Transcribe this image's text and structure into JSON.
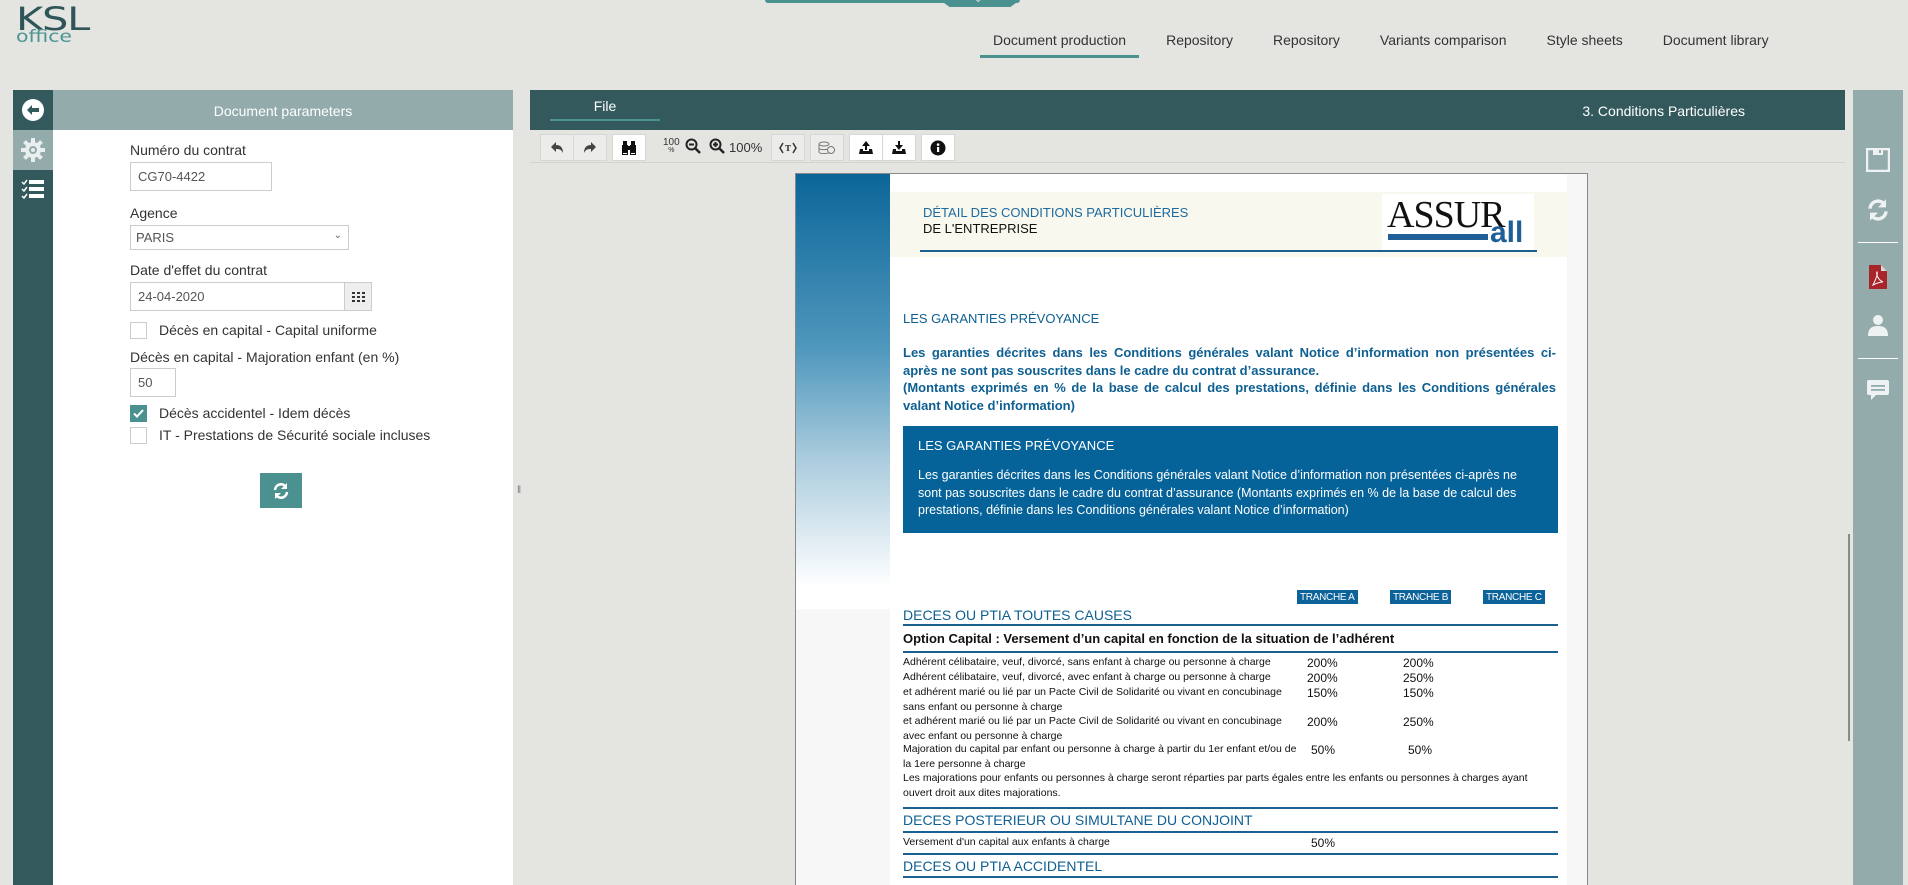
{
  "app": {
    "logo_line1": "KSL",
    "logo_line2": "OFFICE"
  },
  "nav": {
    "tabs": [
      {
        "label": "Document production",
        "active": true
      },
      {
        "label": "Repository"
      },
      {
        "label": "Repository"
      },
      {
        "label": "Variants comparison"
      },
      {
        "label": "Style sheets"
      },
      {
        "label": "Document library"
      }
    ]
  },
  "left_rail": {
    "icons": [
      "back-arrow-icon",
      "gear-icon",
      "checklist-icon"
    ]
  },
  "params": {
    "header": "Document parameters",
    "contract_number_label": "Numéro du contrat",
    "contract_number_value": "CG70-4422",
    "agency_label": "Agence",
    "agency_value": "PARIS",
    "date_label": "Date d'effet du contrat",
    "date_value": "24-04-2020",
    "checkbox_capital_uniforme": {
      "label": "Décès en capital - Capital uniforme",
      "checked": false
    },
    "majoration_label": "Décès en capital - Majoration enfant (en %)",
    "majoration_value": "50",
    "checkbox_accidentel": {
      "label": "Décès accidentel - Idem décès",
      "checked": true
    },
    "checkbox_it": {
      "label": "IT - Prestations de Sécurité sociale incluses",
      "checked": false
    }
  },
  "document": {
    "file_tab": "File",
    "title": "3. Conditions Particulières",
    "zoom_level": "100%",
    "zoom_100_label": "100",
    "page": {
      "header_line1": "DÉTAIL DES CONDITIONS PARTICULIÈRES",
      "header_line2": "DE L'ENTREPRISE",
      "logo_main": "ASSUR",
      "logo_sub": "all",
      "section_title": "LES GARANTIES PRÉVOYANCE",
      "intro_p1": "Les garanties décrites dans les Conditions générales valant Notice d’information non présentées ci-après ne sont pas souscrites dans le cadre du contrat d’assurance.",
      "intro_p2": "(Montants exprimés en % de la base de calcul des prestations, définie dans les Conditions générales valant Notice d’information)",
      "box_title": "LES GARANTIES PRÉVOYANCE",
      "box_text": "Les garanties décrites dans les Conditions générales valant Notice d’information non présentées ci-après ne sont pas souscrites dans le cadre du contrat d’assurance (Montants exprimés en % de la base de calcul des prestations, définie dans les Conditions générales valant Notice d’information)",
      "tranches": [
        "TRANCHE A",
        "TRANCHE B",
        "TRANCHE C"
      ],
      "sec1_title": "DECES OU PTIA TOUTES CAUSES",
      "sec1_option": "Option Capital : Versement d’un capital en fonction de la situation de l’adhérent",
      "sec1_rows": [
        {
          "label": "Adhérent célibataire, veuf, divorcé, sans enfant à charge ou personne à charge",
          "a": "200%",
          "b": "200%"
        },
        {
          "label": "Adhérent célibataire, veuf, divorcé, avec enfant à charge ou personne à charge",
          "a": "200%",
          "b": "250%"
        },
        {
          "label": "et adhérent marié ou lié par un Pacte Civil de Solidarité ou vivant en concubinage sans enfant ou personne à charge",
          "a": "150%",
          "b": "150%"
        },
        {
          "label": "et adhérent marié ou lié par un Pacte Civil de Solidarité ou vivant en concubinage avec enfant ou personne à charge",
          "a": "200%",
          "b": "250%"
        },
        {
          "label": "Majoration du capital par enfant ou personne à charge à partir du 1er enfant et/ou de la 1ere personne à charge",
          "a": "50%",
          "b": "50%"
        }
      ],
      "sec1_note": "Les majorations pour enfants ou personnes à charge seront réparties par parts égales entre les enfants ou personnes à charges ayant ouvert droit aux dites majorations.",
      "sec2_title": "DECES POSTERIEUR OU SIMULTANE DU CONJOINT",
      "sec2_row": {
        "label": "Versement d'un capital aux enfants à charge",
        "a": "50%"
      },
      "sec3_title": "DECES OU PTIA ACCIDENTEL"
    }
  },
  "right_rail": {
    "icons": [
      "save-icon",
      "sync-icon",
      "pdf-icon",
      "user-icon",
      "comment-icon"
    ]
  },
  "colors": {
    "teal_dark": "#33595c",
    "teal_accent": "#4a918f",
    "teal_light": "#93abab",
    "doc_blue": "#0c639a"
  }
}
